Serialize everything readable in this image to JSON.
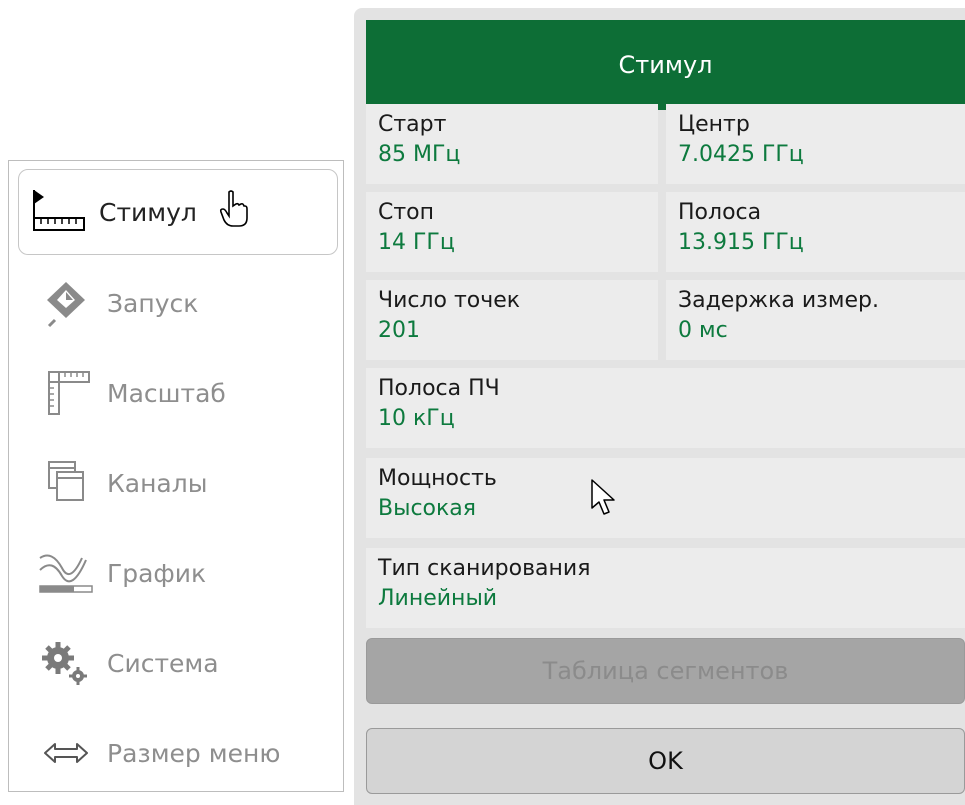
{
  "menu": {
    "items": [
      {
        "label": "Стимул",
        "icon": "ruler-icon",
        "active": true
      },
      {
        "label": "Запуск",
        "icon": "trigger-icon"
      },
      {
        "label": "Масштаб",
        "icon": "scale-icon"
      },
      {
        "label": "Каналы",
        "icon": "channels-icon"
      },
      {
        "label": "График",
        "icon": "trace-icon"
      },
      {
        "label": "Система",
        "icon": "gears-icon"
      },
      {
        "label": "Размер меню",
        "icon": "resize-arrows-icon"
      }
    ]
  },
  "panel": {
    "title": "Стимул",
    "fields": {
      "start": {
        "name": "Старт",
        "value": "85 МГц"
      },
      "center": {
        "name": "Центр",
        "value": "7.0425 ГГц"
      },
      "stop": {
        "name": "Стоп",
        "value": "14 ГГц"
      },
      "span": {
        "name": "Полоса",
        "value": "13.915 ГГц"
      },
      "points": {
        "name": "Число точек",
        "value": "201"
      },
      "delay": {
        "name": "Задержка измер.",
        "value": "0 мс"
      },
      "ifbw": {
        "name": "Полоса ПЧ",
        "value": "10 кГц"
      },
      "power": {
        "name": "Мощность",
        "value": "Высокая"
      },
      "sweep": {
        "name": "Тип сканирования",
        "value": "Линейный"
      }
    },
    "segment_table_label": "Таблица сегментов",
    "ok_label": "OK"
  },
  "colors": {
    "header_bg": "#0d6e36",
    "value_text": "#0d7a3e",
    "panel_bg": "#e3e3e3"
  }
}
